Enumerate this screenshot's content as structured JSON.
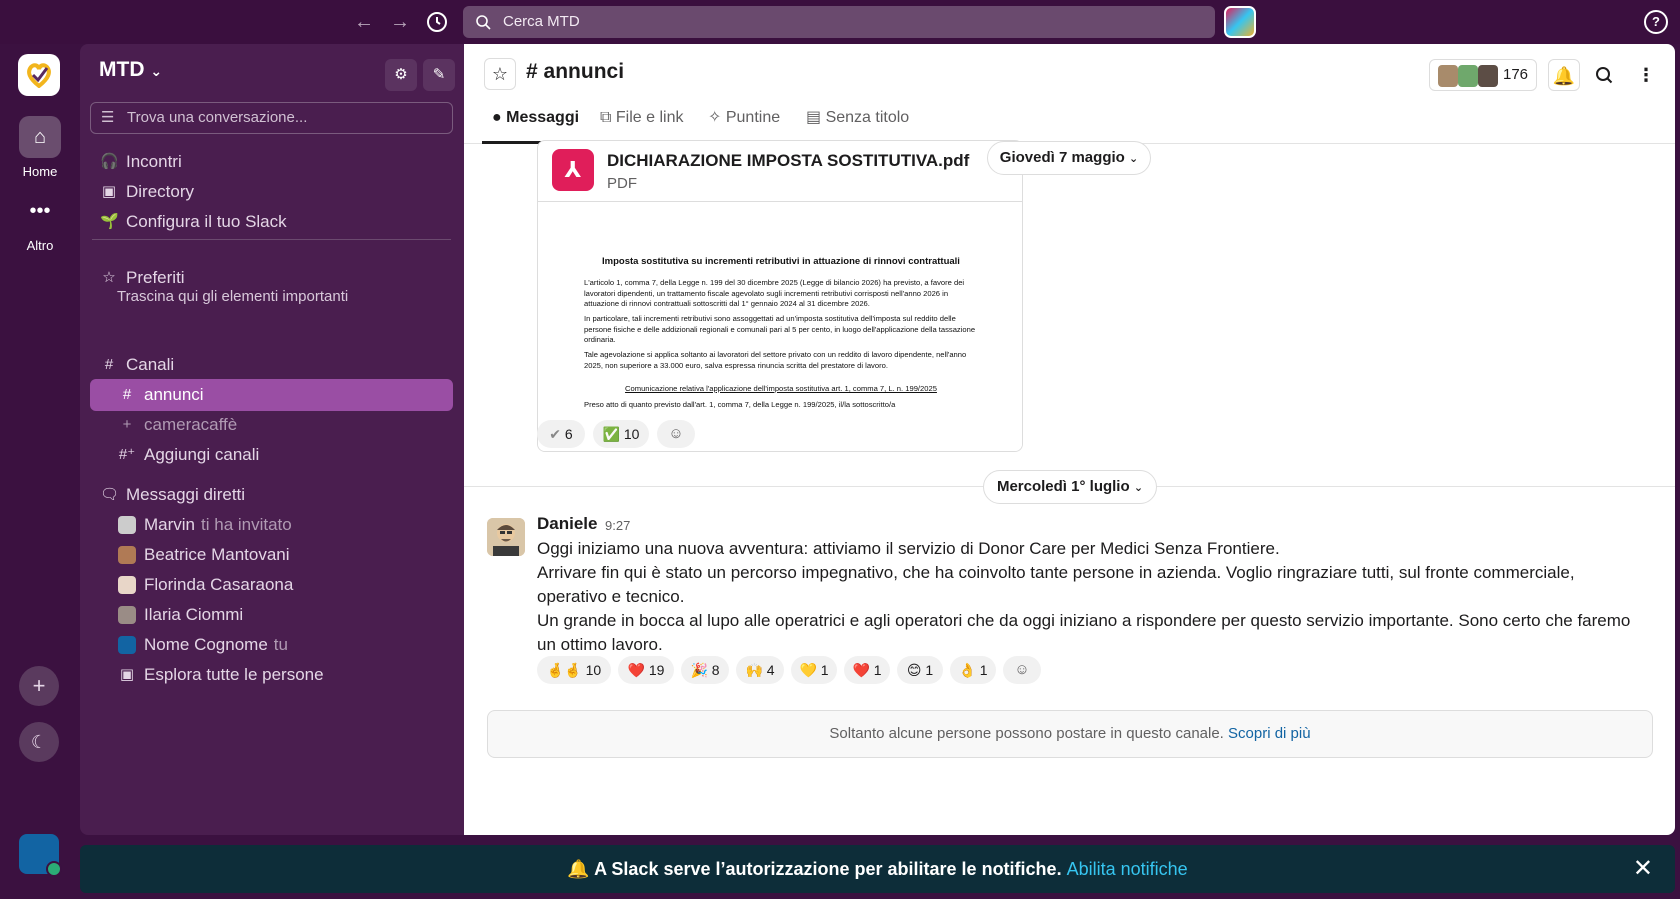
{
  "topbar": {
    "search_placeholder": "Cerca MTD",
    "help": "?"
  },
  "rail": {
    "home_label": "Home",
    "more_label": "Altro"
  },
  "sidebar": {
    "workspace": "MTD",
    "search_placeholder": "Trova una conversazione...",
    "top_items": [
      {
        "label": "Incontri",
        "icon": "headphones-icon"
      },
      {
        "label": "Directory",
        "icon": "contact-card-icon"
      },
      {
        "label": "Configura il tuo Slack",
        "icon": "seedling-icon"
      }
    ],
    "favorites": {
      "header": "Preferiti",
      "hint": "Trascina qui gli elementi importanti"
    },
    "channels": {
      "header": "Canali",
      "items": [
        {
          "label": "annunci",
          "prefix": "#"
        },
        {
          "label": "cameracaffè",
          "prefix": "+"
        },
        {
          "label": "Aggiungi canali",
          "prefix": "add-channel-icon"
        }
      ]
    },
    "dms": {
      "header": "Messaggi diretti",
      "items": [
        {
          "label": "Marvin",
          "extra": "ti ha invitato"
        },
        {
          "label": "Beatrice Mantovani",
          "extra": ""
        },
        {
          "label": "Florinda Casaraona",
          "extra": ""
        },
        {
          "label": "Ilaria Ciommi",
          "extra": ""
        },
        {
          "label": "Nome Cognome",
          "extra": "tu"
        },
        {
          "label": "Esplora tutte le persone",
          "extra": ""
        }
      ]
    }
  },
  "channel": {
    "name": "annunci",
    "hash": "#",
    "member_count": "176",
    "tabs": [
      "Messaggi",
      "File e link",
      "Puntine",
      "Senza titolo"
    ]
  },
  "file": {
    "name": "DICHIARAZIONE IMPOSTA SOSTITUTIVA.pdf",
    "type": "PDF",
    "preview": {
      "title": "Imposta sostitutiva su incrementi retributivi in attuazione di rinnovi contrattuali",
      "p1": "L'articolo 1, comma 7, della Legge n. 199 del 30 dicembre 2025 (Legge di bilancio 2026) ha previsto, a favore dei lavoratori dipendenti, un trattamento fiscale agevolato sugli incrementi retributivi corrisposti nell'anno 2026 in attuazione di rinnovi contrattuali sottoscritti dal 1° gennaio 2024 al 31 dicembre 2026.",
      "p2": "In particolare, tali incrementi retributivi sono assoggettati ad un'imposta sostitutiva dell'imposta sul reddito delle persone fisiche e delle addizionali regionali e comunali pari al 5 per cento, in luogo dell'applicazione della tassazione ordinaria.",
      "p3": "Tale agevolazione si applica soltanto ai lavoratori del settore privato con un reddito di lavoro dipendente, nell'anno 2025, non superiore a 33.000 euro, salva espressa rinuncia scritta del prestatore di lavoro.",
      "link": "Comunicazione relativa l'applicazione dell'imposta sostitutiva art. 1, comma 7, L. n. 199/2025",
      "p4": "Preso atto di quanto previsto dall'art. 1, comma 7, della Legge n. 199/2025, il/la sottoscritto/a"
    },
    "reactions": [
      {
        "emoji": "✔",
        "count": "6"
      },
      {
        "emoji": "✅",
        "count": "10"
      }
    ]
  },
  "dates": {
    "first": "Giovedì 7 maggio",
    "second": "Mercoledì 1° luglio"
  },
  "message": {
    "author": "Daniele",
    "time": "9:27",
    "lines": [
      "Oggi iniziamo una nuova avventura: attiviamo il servizio di Donor Care per Medici Senza Frontiere.",
      "Arrivare fin qui è stato un percorso impegnativo, che ha coinvolto tante persone in azienda. Voglio ringraziare tutti, sul fronte commerciale, operativo e tecnico.",
      "Un grande in bocca al lupo alle operatrici e agli operatori che da oggi iniziano a rispondere per questo servizio importante. Sono certo che faremo un ottimo lavoro."
    ],
    "reactions": [
      {
        "emoji": "🤞🤞",
        "count": "10"
      },
      {
        "emoji": "❤️",
        "count": "19"
      },
      {
        "emoji": "🎉",
        "count": "8"
      },
      {
        "emoji": "🙌",
        "count": "4"
      },
      {
        "emoji": "💛",
        "count": "1"
      },
      {
        "emoji": "❤️",
        "count": "1"
      },
      {
        "emoji": "😊",
        "count": "1"
      },
      {
        "emoji": "👌",
        "count": "1"
      }
    ]
  },
  "restriction": {
    "text": "Soltanto alcune persone possono postare in questo canale.",
    "link": "Scopri di più"
  },
  "banner": {
    "text": "A Slack serve l’autorizzazione per abilitare le notifiche.",
    "link": "Abilita notifiche"
  },
  "colors": {
    "aubergine": "#3b1140",
    "sidebar": "#4a1e4f",
    "active_channel": "#9a4ea4",
    "link": "#1264a3"
  }
}
